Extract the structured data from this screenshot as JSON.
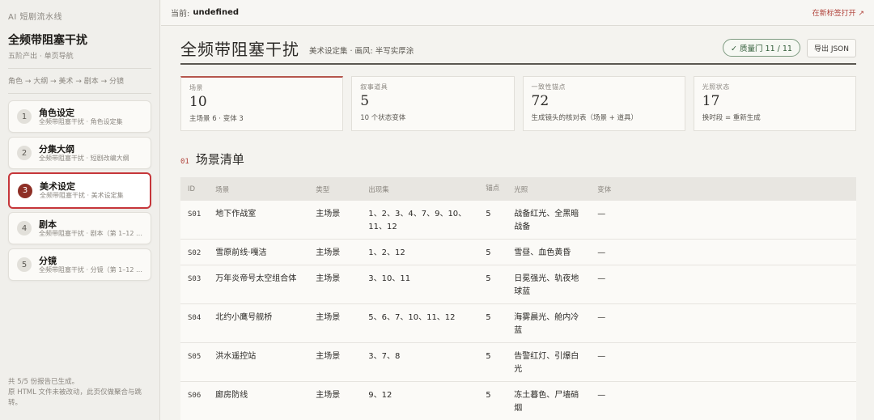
{
  "sidebar": {
    "brand": "AI 短剧流水线",
    "title": "全频带阻塞干扰",
    "subtitle": "五阶产出 · 单页导航",
    "flow": "角色 → 大纲 → 美术 → 剧本 → 分镜",
    "items": [
      {
        "num": "1",
        "label": "角色设定",
        "meta": "全频带阻塞干扰 · 角色设定集"
      },
      {
        "num": "2",
        "label": "分集大纲",
        "meta": "全频带阻塞干扰 · 短剧改编大纲"
      },
      {
        "num": "3",
        "label": "美术设定",
        "meta": "全频带阻塞干扰 · 美术设定集"
      },
      {
        "num": "4",
        "label": "剧本",
        "meta": "全频带阻塞干扰 · 剧本（第 1–12 集）"
      },
      {
        "num": "5",
        "label": "分镜",
        "meta": "全频带阻塞干扰 · 分镜（第 1–12 集）"
      }
    ],
    "footer_line1": "共 5/5 份报告已生成。",
    "footer_line2": "原 HTML 文件未被改动，此页仅做聚合与跳转。"
  },
  "topbar": {
    "current_label": "当前:",
    "current_value": "undefined",
    "open_link": "在新标签打开 ↗"
  },
  "page": {
    "title": "全频带阻塞干扰",
    "subtitle": "美术设定集 · 画风: 半写实厚涂",
    "quality": "✓ 质量门 11 / 11",
    "export": "导出 JSON"
  },
  "stats": [
    {
      "label": "场景",
      "value": "10",
      "desc": "主场景 6 · 变体 3"
    },
    {
      "label": "叙事道具",
      "value": "5",
      "desc": "10 个状态变体"
    },
    {
      "label": "一致性锚点",
      "value": "72",
      "desc": "生成镜头的核对表（场景 + 道具）"
    },
    {
      "label": "光照状态",
      "value": "17",
      "desc": "换时段 = 重新生成"
    }
  ],
  "section": {
    "num": "01",
    "title": "场景清单"
  },
  "table": {
    "headers": [
      "ID",
      "场景",
      "类型",
      "出现集",
      "锚点",
      "光照",
      "变体"
    ],
    "rows": [
      {
        "id": "S01",
        "scene": "地下作战室",
        "type": "主场景",
        "episodes": "1、2、3、4、7、9、10、11、12",
        "anchors": "5",
        "lighting": "战备红光、全黑暗战备",
        "variant": "—"
      },
      {
        "id": "S02",
        "scene": "雪原前线·嘎洁",
        "type": "主场景",
        "episodes": "1、2、12",
        "anchors": "5",
        "lighting": "雪昼、血色黄昏",
        "variant": "—"
      },
      {
        "id": "S03",
        "scene": "万年炎帝号太空组合体",
        "type": "主场景",
        "episodes": "3、10、11",
        "anchors": "5",
        "lighting": "日冕强光、轨夜地球蓝",
        "variant": "—"
      },
      {
        "id": "S04",
        "scene": "北约小鹰号舰桥",
        "type": "主场景",
        "episodes": "5、6、7、10、11、12",
        "anchors": "5",
        "lighting": "海雾晨光、舱内冷蓝",
        "variant": "—"
      },
      {
        "id": "S05",
        "scene": "洪水遥控站",
        "type": "主场景",
        "episodes": "3、7、8",
        "anchors": "5",
        "lighting": "告警红灯、引爆白光",
        "variant": "—"
      },
      {
        "id": "S06",
        "scene": "廊房防线",
        "type": "主场景",
        "episodes": "9、12",
        "anchors": "5",
        "lighting": "冻土暮色、尸墙硝烟",
        "variant": "—"
      }
    ]
  },
  "colors": {
    "accent_red": "#c6363a",
    "active_num_bg": "#8e2f26",
    "quality_green": "#2f5a36"
  }
}
